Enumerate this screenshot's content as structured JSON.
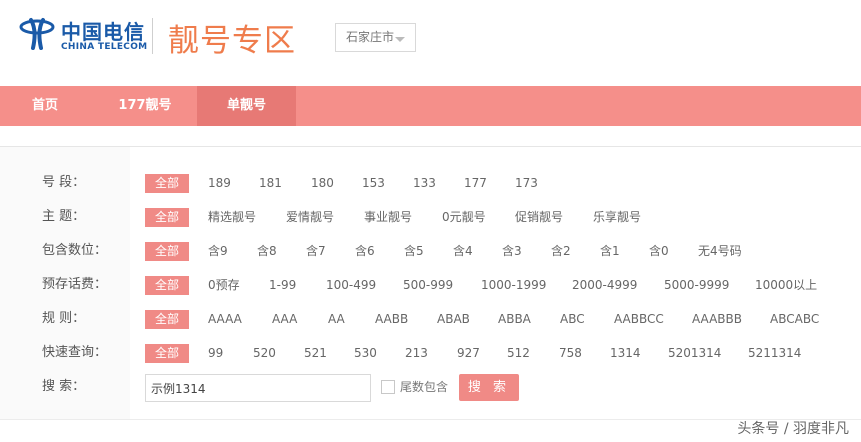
{
  "header": {
    "logo_cn": "中国电信",
    "logo_en": "CHINA TELECOM",
    "zone_title": "靓号专区",
    "city": "石家庄市",
    "brand_color": "#1a5aa8",
    "accent_color": "#f08a86"
  },
  "nav": {
    "items": [
      {
        "label": "首页"
      },
      {
        "label": "177靓号"
      },
      {
        "label": "单靓号",
        "active": true
      }
    ]
  },
  "filters": [
    {
      "label": "号    段：",
      "all": "全部",
      "options": [
        "189",
        "181",
        "180",
        "153",
        "133",
        "177",
        "173"
      ]
    },
    {
      "label": "主    题：",
      "all": "全部",
      "options": [
        "精选靓号",
        "爱情靓号",
        "事业靓号",
        "0元靓号",
        "促销靓号",
        "乐享靓号"
      ]
    },
    {
      "label": "包含数位：",
      "all": "全部",
      "options": [
        "含9",
        "含8",
        "含7",
        "含6",
        "含5",
        "含4",
        "含3",
        "含2",
        "含1",
        "含0",
        "无4号码"
      ]
    },
    {
      "label": "预存话费：",
      "all": "全部",
      "options": [
        "0预存",
        "1-99",
        "100-499",
        "500-999",
        "1000-1999",
        "2000-4999",
        "5000-9999",
        "10000以上"
      ]
    },
    {
      "label": "规    则：",
      "all": "全部",
      "options": [
        "AAAA",
        "AAA",
        "AA",
        "AABB",
        "ABAB",
        "ABBA",
        "ABC",
        "AABBCC",
        "AAABBB",
        "ABCABC"
      ]
    },
    {
      "label": "快速查询：",
      "all": "全部",
      "options": [
        "99",
        "520",
        "521",
        "530",
        "213",
        "927",
        "512",
        "758",
        "1314",
        "5201314",
        "5211314"
      ]
    }
  ],
  "search": {
    "label": "搜    索：",
    "value": "示例1314",
    "tail_label": "尾数包含",
    "tail_checked": false,
    "button": "搜 索"
  },
  "watermark": "头条号 / 羽度非凡"
}
